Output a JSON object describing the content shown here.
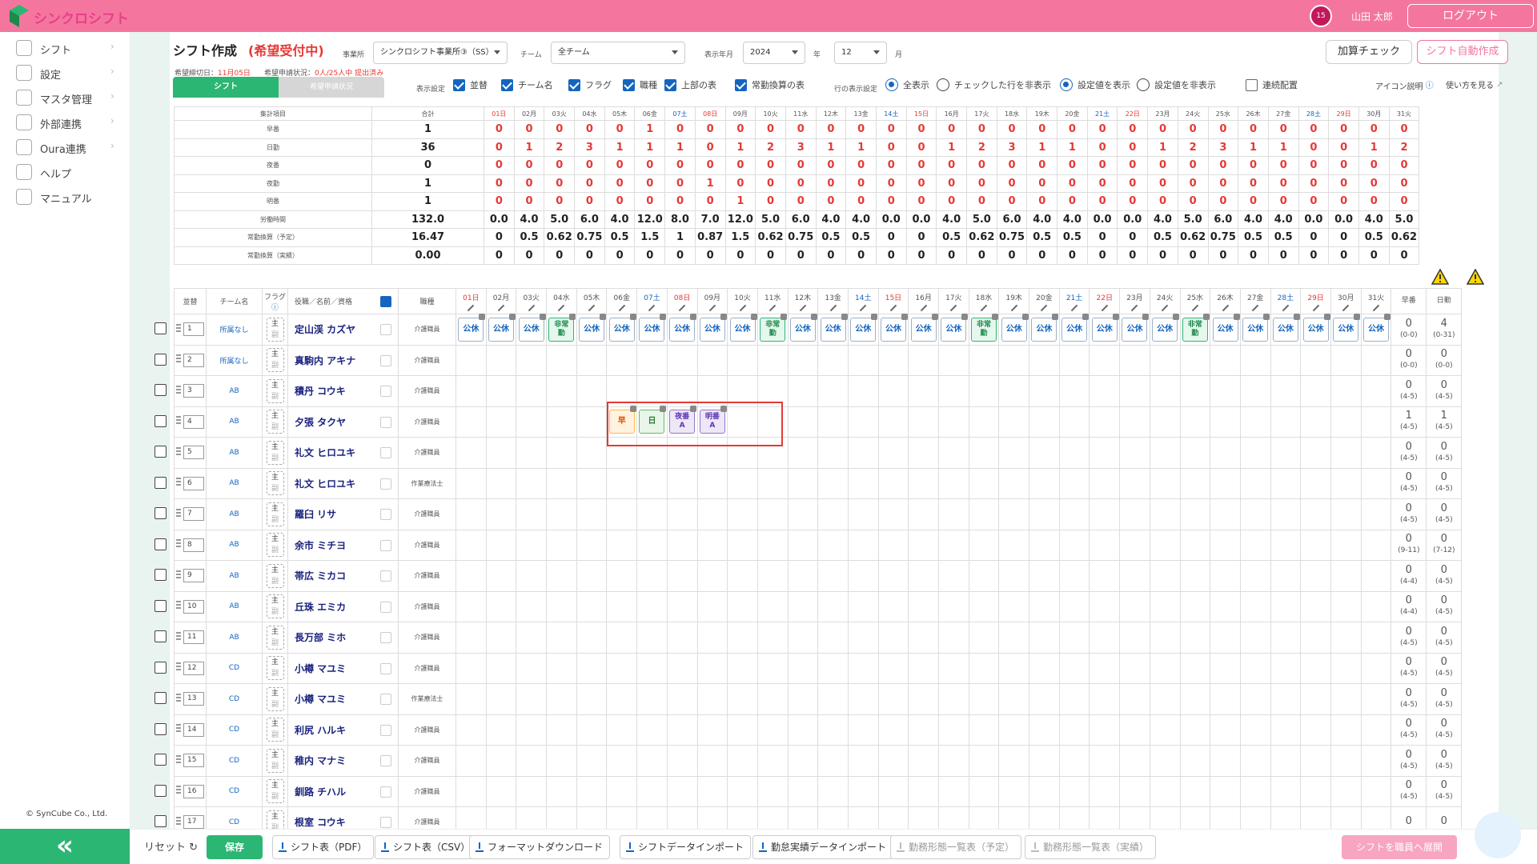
{
  "app": {
    "logo_text": "シンクロシフト",
    "username": "山田 太郎",
    "logout": "ログアウト",
    "calendar_badge": "15"
  },
  "sidebar": {
    "items": [
      {
        "label": "シフト",
        "icon": "calendar-icon"
      },
      {
        "label": "設定",
        "icon": "gear-icon"
      },
      {
        "label": "マスタ管理",
        "icon": "database-icon"
      },
      {
        "label": "外部連携",
        "icon": "cloud-icon"
      },
      {
        "label": "Oura連携",
        "icon": "database-icon"
      },
      {
        "label": "ヘルプ",
        "icon": "help-icon"
      },
      {
        "label": "マニュアル",
        "icon": "edit-icon"
      }
    ],
    "copyright": "© SynCube Co., Ltd.",
    "collapse": "«"
  },
  "header": {
    "title": "シフト作成",
    "status": "(希望受付中)",
    "deadline_label": "希望締切日：",
    "deadline": "11月05日",
    "req_label": "希望申請状況：",
    "req_status": "0人/25人中 提出済み",
    "office_label": "事業所",
    "office_value": "シンクロシフト事業所③（SS）",
    "team_label": "チーム",
    "team_value": "全チーム",
    "period_label": "表示年月",
    "year": "2024",
    "year_unit": "年",
    "month": "12",
    "month_unit": "月",
    "check_btn": "加算チェック",
    "auto_btn": "シフト自動作成"
  },
  "tabs": {
    "shift": "シフト",
    "request": "希望申請状況"
  },
  "display": {
    "label": "表示設定",
    "checks": [
      {
        "label": "並替",
        "on": true
      },
      {
        "label": "チーム名",
        "on": true
      },
      {
        "label": "フラグ",
        "on": true
      },
      {
        "label": "職種",
        "on": true
      },
      {
        "label": "上部の表",
        "on": true
      },
      {
        "label": "常勤換算の表",
        "on": true
      }
    ],
    "row_label": "行の表示設定",
    "radios": [
      {
        "label": "全表示",
        "on": true
      },
      {
        "label": "チェックした行を非表示",
        "on": false
      },
      {
        "label": "設定値を表示",
        "on": true
      },
      {
        "label": "設定値を非表示",
        "on": false
      }
    ],
    "consecutive": "連続配置",
    "icon_help": "アイコン説明",
    "howto": "使い方を見る"
  },
  "days": [
    {
      "d": "01",
      "w": "日"
    },
    {
      "d": "02",
      "w": "月"
    },
    {
      "d": "03",
      "w": "火"
    },
    {
      "d": "04",
      "w": "水"
    },
    {
      "d": "05",
      "w": "木"
    },
    {
      "d": "06",
      "w": "金"
    },
    {
      "d": "07",
      "w": "土"
    },
    {
      "d": "08",
      "w": "日"
    },
    {
      "d": "09",
      "w": "月"
    },
    {
      "d": "10",
      "w": "火"
    },
    {
      "d": "11",
      "w": "水"
    },
    {
      "d": "12",
      "w": "木"
    },
    {
      "d": "13",
      "w": "金"
    },
    {
      "d": "14",
      "w": "土"
    },
    {
      "d": "15",
      "w": "日"
    },
    {
      "d": "16",
      "w": "月"
    },
    {
      "d": "17",
      "w": "火"
    },
    {
      "d": "18",
      "w": "水"
    },
    {
      "d": "19",
      "w": "木"
    },
    {
      "d": "20",
      "w": "金"
    },
    {
      "d": "21",
      "w": "土"
    },
    {
      "d": "22",
      "w": "日"
    },
    {
      "d": "23",
      "w": "月"
    },
    {
      "d": "24",
      "w": "火"
    },
    {
      "d": "25",
      "w": "水"
    },
    {
      "d": "26",
      "w": "木"
    },
    {
      "d": "27",
      "w": "金"
    },
    {
      "d": "28",
      "w": "土"
    },
    {
      "d": "29",
      "w": "日"
    },
    {
      "d": "30",
      "w": "月"
    },
    {
      "d": "31",
      "w": "火"
    }
  ],
  "summary": {
    "col_item": "集計項目",
    "col_total": "合計",
    "rows": [
      {
        "name": "早番",
        "total": "1",
        "red": true,
        "vals": [
          "0",
          "0",
          "0",
          "0",
          "0",
          "1",
          "0",
          "0",
          "0",
          "0",
          "0",
          "0",
          "0",
          "0",
          "0",
          "0",
          "0",
          "0",
          "0",
          "0",
          "0",
          "0",
          "0",
          "0",
          "0",
          "0",
          "0",
          "0",
          "0",
          "0",
          "0"
        ]
      },
      {
        "name": "日勤",
        "total": "36",
        "red": true,
        "vals": [
          "0",
          "1",
          "2",
          "3",
          "1",
          "1",
          "1",
          "0",
          "1",
          "2",
          "3",
          "1",
          "1",
          "0",
          "0",
          "1",
          "2",
          "3",
          "1",
          "1",
          "0",
          "0",
          "1",
          "2",
          "3",
          "1",
          "1",
          "0",
          "0",
          "1",
          "2"
        ]
      },
      {
        "name": "夜番",
        "total": "0",
        "red": true,
        "vals": [
          "0",
          "0",
          "0",
          "0",
          "0",
          "0",
          "0",
          "0",
          "0",
          "0",
          "0",
          "0",
          "0",
          "0",
          "0",
          "0",
          "0",
          "0",
          "0",
          "0",
          "0",
          "0",
          "0",
          "0",
          "0",
          "0",
          "0",
          "0",
          "0",
          "0",
          "0"
        ]
      },
      {
        "name": "夜勤",
        "total": "1",
        "red": true,
        "vals": [
          "0",
          "0",
          "0",
          "0",
          "0",
          "0",
          "0",
          "1",
          "0",
          "0",
          "0",
          "0",
          "0",
          "0",
          "0",
          "0",
          "0",
          "0",
          "0",
          "0",
          "0",
          "0",
          "0",
          "0",
          "0",
          "0",
          "0",
          "0",
          "0",
          "0",
          "0"
        ]
      },
      {
        "name": "明番",
        "total": "1",
        "red": true,
        "vals": [
          "0",
          "0",
          "0",
          "0",
          "0",
          "0",
          "0",
          "0",
          "1",
          "0",
          "0",
          "0",
          "0",
          "0",
          "0",
          "0",
          "0",
          "0",
          "0",
          "0",
          "0",
          "0",
          "0",
          "0",
          "0",
          "0",
          "0",
          "0",
          "0",
          "0",
          "0"
        ]
      },
      {
        "name": "労働時間",
        "total": "132.0",
        "red": false,
        "vals": [
          "0.0",
          "4.0",
          "5.0",
          "6.0",
          "4.0",
          "12.0",
          "8.0",
          "7.0",
          "12.0",
          "5.0",
          "6.0",
          "4.0",
          "4.0",
          "0.0",
          "0.0",
          "4.0",
          "5.0",
          "6.0",
          "4.0",
          "4.0",
          "0.0",
          "0.0",
          "4.0",
          "5.0",
          "6.0",
          "4.0",
          "4.0",
          "0.0",
          "0.0",
          "4.0",
          "5.0"
        ]
      },
      {
        "name": "常勤換算（予定）",
        "total": "16.47",
        "red": false,
        "vals": [
          "0",
          "0.5",
          "0.62",
          "0.75",
          "0.5",
          "1.5",
          "1",
          "0.87",
          "1.5",
          "0.62",
          "0.75",
          "0.5",
          "0.5",
          "0",
          "0",
          "0.5",
          "0.62",
          "0.75",
          "0.5",
          "0.5",
          "0",
          "0",
          "0.5",
          "0.62",
          "0.75",
          "0.5",
          "0.5",
          "0",
          "0",
          "0.5",
          "0.62"
        ]
      },
      {
        "name": "常勤換算（実績）",
        "total": "0.00",
        "red": false,
        "vals": [
          "0",
          "0",
          "0",
          "0",
          "0",
          "0",
          "0",
          "0",
          "0",
          "0",
          "0",
          "0",
          "0",
          "0",
          "0",
          "0",
          "0",
          "0",
          "0",
          "0",
          "0",
          "0",
          "0",
          "0",
          "0",
          "0",
          "0",
          "0",
          "0",
          "0",
          "0"
        ]
      }
    ]
  },
  "staff_header": {
    "order": "並替",
    "team": "チーム名",
    "flag": "フラグ",
    "name": "役職／名前／資格",
    "job": "職種",
    "sum1": "早番",
    "sum2": "日勤"
  },
  "flag": {
    "main": "主",
    "sub": "副"
  },
  "staff": [
    {
      "no": "1",
      "team": "所属なし",
      "name": "定山渓 カズヤ",
      "job": "介護職員",
      "s1": "0",
      "r1": "(0-0)",
      "s2": "4",
      "r2": "(0-31)",
      "red": false
    },
    {
      "no": "2",
      "team": "所属なし",
      "name": "真駒内 アキナ",
      "job": "介護職員",
      "s1": "0",
      "r1": "(0-0)",
      "s2": "0",
      "r2": "(0-0)",
      "red": false
    },
    {
      "no": "3",
      "team": "AB",
      "name": "積丹 コウキ",
      "job": "介護職員",
      "s1": "0",
      "r1": "(4-5)",
      "s2": "0",
      "r2": "(4-5)",
      "red": true
    },
    {
      "no": "4",
      "team": "AB",
      "name": "夕張 タクヤ",
      "job": "介護職員",
      "s1": "1",
      "r1": "(4-5)",
      "s2": "1",
      "r2": "(4-5)",
      "red": true
    },
    {
      "no": "5",
      "team": "AB",
      "name": "礼文 ヒロユキ",
      "job": "介護職員",
      "s1": "0",
      "r1": "(4-5)",
      "s2": "0",
      "r2": "(4-5)",
      "red": true
    },
    {
      "no": "6",
      "team": "AB",
      "name": "礼文 ヒロユキ",
      "job": "作業療法士",
      "s1": "0",
      "r1": "(4-5)",
      "s2": "0",
      "r2": "(4-5)",
      "red": true
    },
    {
      "no": "7",
      "team": "AB",
      "name": "羅臼 リサ",
      "job": "介護職員",
      "s1": "0",
      "r1": "(4-5)",
      "s2": "0",
      "r2": "(4-5)",
      "red": true
    },
    {
      "no": "8",
      "team": "AB",
      "name": "余市 ミチヨ",
      "job": "介護職員",
      "s1": "0",
      "r1": "(9-11)",
      "s2": "0",
      "r2": "(7-12)",
      "red": true
    },
    {
      "no": "9",
      "team": "AB",
      "name": "帯広 ミカコ",
      "job": "介護職員",
      "s1": "0",
      "r1": "(4-4)",
      "s2": "0",
      "r2": "(4-5)",
      "red": true
    },
    {
      "no": "10",
      "team": "AB",
      "name": "丘珠 エミカ",
      "job": "介護職員",
      "s1": "0",
      "r1": "(4-4)",
      "s2": "0",
      "r2": "(4-5)",
      "red": true
    },
    {
      "no": "11",
      "team": "AB",
      "name": "長万部 ミホ",
      "job": "介護職員",
      "s1": "0",
      "r1": "(4-5)",
      "s2": "0",
      "r2": "(4-5)",
      "red": true
    },
    {
      "no": "12",
      "team": "CD",
      "name": "小樽 マユミ",
      "job": "介護職員",
      "s1": "0",
      "r1": "(4-5)",
      "s2": "0",
      "r2": "(4-5)",
      "red": true
    },
    {
      "no": "13",
      "team": "CD",
      "name": "小樽 マユミ",
      "job": "作業療法士",
      "s1": "0",
      "r1": "(4-5)",
      "s2": "0",
      "r2": "(4-5)",
      "red": true
    },
    {
      "no": "14",
      "team": "CD",
      "name": "利尻 ハルキ",
      "job": "介護職員",
      "s1": "0",
      "r1": "(4-5)",
      "s2": "0",
      "r2": "(4-5)",
      "red": true
    },
    {
      "no": "15",
      "team": "CD",
      "name": "稚内 マナミ",
      "job": "介護職員",
      "s1": "0",
      "r1": "(4-5)",
      "s2": "0",
      "r2": "(4-5)",
      "red": true
    },
    {
      "no": "16",
      "team": "CD",
      "name": "釧路 チハル",
      "job": "介護職員",
      "s1": "0",
      "r1": "(4-5)",
      "s2": "0",
      "r2": "(4-5)",
      "red": true
    },
    {
      "no": "17",
      "team": "CD",
      "name": "根室 コウキ",
      "job": "介護職員",
      "s1": "0",
      "r1": "",
      "s2": "0",
      "r2": "",
      "red": true
    }
  ],
  "row1_shifts": [
    "公休",
    "公休",
    "公休",
    "非常勤",
    "公休",
    "公休",
    "公休",
    "公休",
    "公休",
    "公休",
    "非常勤",
    "公休",
    "公休",
    "公休",
    "公休",
    "公休",
    "公休",
    "非常勤",
    "公休",
    "公休",
    "公休",
    "公休",
    "公休",
    "公休",
    "非常勤",
    "公休",
    "公休",
    "公休",
    "公休",
    "公休",
    "公休"
  ],
  "row4_shifts": [
    {
      "day": 6,
      "label": "早",
      "cls": "e"
    },
    {
      "day": 7,
      "label": "日",
      "cls": "d"
    },
    {
      "day": 8,
      "label": "夜番A",
      "cls": "n"
    },
    {
      "day": 9,
      "label": "明番A",
      "cls": "n"
    }
  ],
  "bottom": {
    "reset": "リセット",
    "save": "保存",
    "buttons": [
      "シフト表（PDF）",
      "シフト表（CSV）",
      "フォーマットダウンロード",
      "シフトデータインポート",
      "勤怠実績データインポート",
      "勤務形態一覧表（予定）",
      "勤務形態一覧表（実績）"
    ],
    "deploy": "シフトを職員へ展開"
  },
  "colors": {
    "brand_pink": "#f4769e",
    "brand_green": "#2bb673",
    "red": "#e53935",
    "blue": "#1565c0"
  }
}
